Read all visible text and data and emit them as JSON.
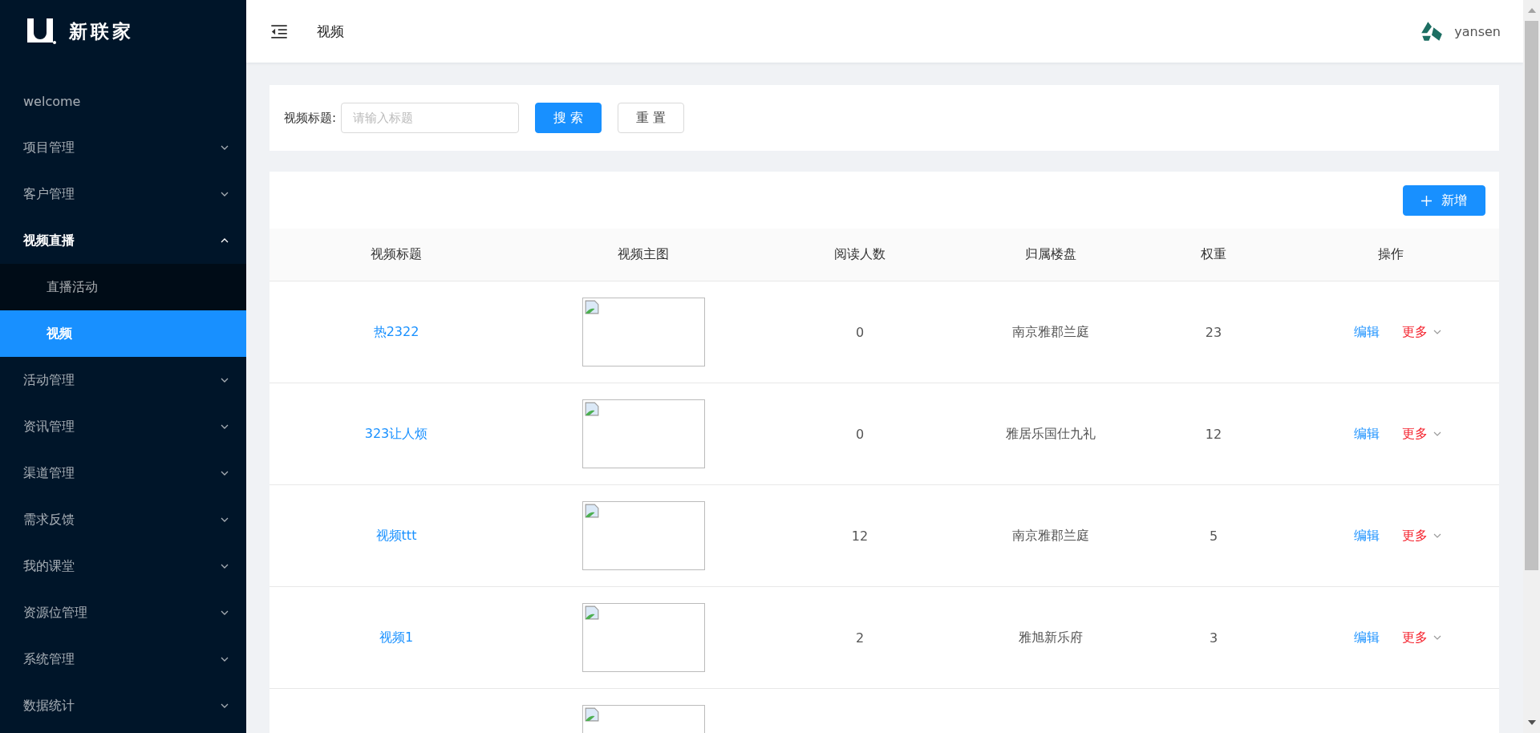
{
  "sidebar": {
    "brand": "新联家",
    "items": [
      {
        "label": "welcome",
        "selected": false
      },
      {
        "label": "项目管理",
        "expanded": false,
        "selected": false
      },
      {
        "label": "客户管理",
        "expanded": false,
        "selected": false
      },
      {
        "label": "视频直播",
        "expanded": true,
        "selected": false,
        "children": [
          {
            "label": "直播活动",
            "selected": false
          },
          {
            "label": "视频",
            "selected": true
          }
        ]
      },
      {
        "label": "活动管理",
        "expanded": false,
        "selected": false
      },
      {
        "label": "资讯管理",
        "expanded": false,
        "selected": false
      },
      {
        "label": "渠道管理",
        "expanded": false,
        "selected": false
      },
      {
        "label": "需求反馈",
        "expanded": false,
        "selected": false
      },
      {
        "label": "我的课堂",
        "expanded": false,
        "selected": false
      },
      {
        "label": "资源位管理",
        "expanded": false,
        "selected": false
      },
      {
        "label": "系统管理",
        "expanded": false,
        "selected": false
      },
      {
        "label": "数据统计",
        "expanded": false,
        "selected": false
      }
    ]
  },
  "header": {
    "title": "视频",
    "user": "yansen"
  },
  "search": {
    "label": "视频标题:",
    "placeholder": "请输入标题",
    "search_button": "搜 索",
    "reset_button": "重 置"
  },
  "table": {
    "add_button": "新增",
    "columns": [
      "视频标题",
      "视频主图",
      "阅读人数",
      "归属楼盘",
      "权重",
      "操作"
    ],
    "rows": [
      {
        "title": "热2322",
        "reads": "0",
        "estate": "南京雅郡兰庭",
        "weight": "23",
        "edit": "编辑",
        "more": "更多"
      },
      {
        "title": "323让人烦",
        "reads": "0",
        "estate": "雅居乐国仕九礼",
        "weight": "12",
        "edit": "编辑",
        "more": "更多"
      },
      {
        "title": "视频ttt",
        "reads": "12",
        "estate": "南京雅郡兰庭",
        "weight": "5",
        "edit": "编辑",
        "more": "更多"
      },
      {
        "title": "视频1",
        "reads": "2",
        "estate": "雅旭新乐府",
        "weight": "3",
        "edit": "编辑",
        "more": "更多"
      },
      {}
    ]
  }
}
